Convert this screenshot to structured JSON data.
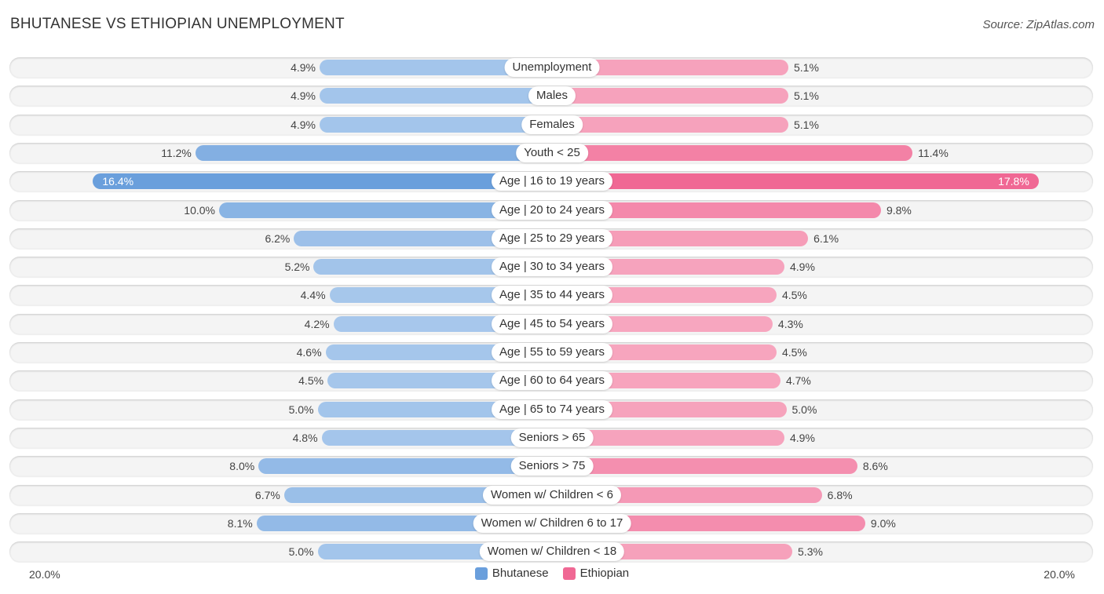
{
  "title": "BHUTANESE VS ETHIOPIAN UNEMPLOYMENT",
  "source": "Source: ZipAtlas.com",
  "chart_data": {
    "type": "bar",
    "orientation": "horizontal-diverging",
    "title": "BHUTANESE VS ETHIOPIAN UNEMPLOYMENT",
    "xlim": [
      0,
      20
    ],
    "axis_labels": {
      "left": "20.0%",
      "right": "20.0%"
    },
    "legend_position": "bottom-center",
    "categories": [
      "Unemployment",
      "Males",
      "Females",
      "Youth < 25",
      "Age | 16 to 19 years",
      "Age | 20 to 24 years",
      "Age | 25 to 29 years",
      "Age | 30 to 34 years",
      "Age | 35 to 44 years",
      "Age | 45 to 54 years",
      "Age | 55 to 59 years",
      "Age | 60 to 64 years",
      "Age | 65 to 74 years",
      "Seniors > 65",
      "Seniors > 75",
      "Women w/ Children < 6",
      "Women w/ Children 6 to 17",
      "Women w/ Children < 18"
    ],
    "series": [
      {
        "name": "Bhutanese",
        "color": "#6a9fdc",
        "light_color": "#a8c8ec",
        "values": [
          4.9,
          4.9,
          4.9,
          11.2,
          16.4,
          10.0,
          6.2,
          5.2,
          4.4,
          4.2,
          4.6,
          4.5,
          5.0,
          4.8,
          8.0,
          6.7,
          8.1,
          5.0
        ],
        "labels": [
          "4.9%",
          "4.9%",
          "4.9%",
          "11.2%",
          "16.4%",
          "10.0%",
          "6.2%",
          "5.2%",
          "4.4%",
          "4.2%",
          "4.6%",
          "4.5%",
          "5.0%",
          "4.8%",
          "8.0%",
          "6.7%",
          "8.1%",
          "5.0%"
        ]
      },
      {
        "name": "Ethiopian",
        "color": "#f06894",
        "light_color": "#f7a8c0",
        "values": [
          5.1,
          5.1,
          5.1,
          11.4,
          17.8,
          9.8,
          6.1,
          4.9,
          4.5,
          4.3,
          4.5,
          4.7,
          5.0,
          4.9,
          8.6,
          6.8,
          9.0,
          5.3
        ],
        "labels": [
          "5.1%",
          "5.1%",
          "5.1%",
          "11.4%",
          "17.8%",
          "9.8%",
          "6.1%",
          "4.9%",
          "4.5%",
          "4.3%",
          "4.5%",
          "4.7%",
          "5.0%",
          "4.9%",
          "8.6%",
          "6.8%",
          "9.0%",
          "5.3%"
        ]
      }
    ]
  },
  "legend": [
    {
      "label": "Bhutanese",
      "color": "#6a9fdc"
    },
    {
      "label": "Ethiopian",
      "color": "#f06894"
    }
  ]
}
